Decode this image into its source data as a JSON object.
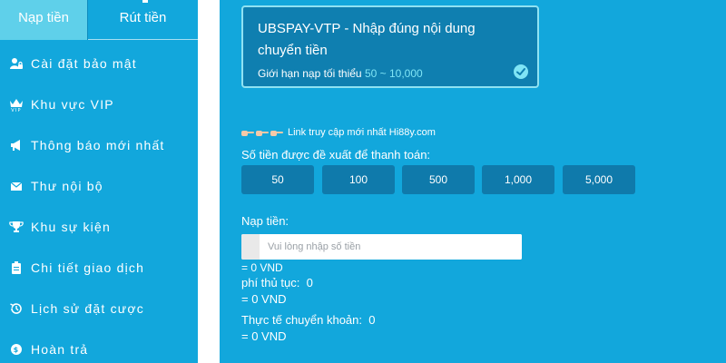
{
  "tabs": {
    "deposit": "Nạp tiền",
    "withdraw": "Rút tiền"
  },
  "sidebar": {
    "items": [
      {
        "label": "Cài đặt bảo mật",
        "icon": "user-lock-icon"
      },
      {
        "label": "Khu vực VIP",
        "icon": "vip-crown-icon"
      },
      {
        "label": "Thông báo mới nhất",
        "icon": "megaphone-icon"
      },
      {
        "label": "Thư nội bộ",
        "icon": "envelope-icon"
      },
      {
        "label": "Khu sự kiện",
        "icon": "trophy-icon"
      },
      {
        "label": "Chi tiết giao dịch",
        "icon": "clipboard-icon"
      },
      {
        "label": "Lịch sử đặt cược",
        "icon": "history-icon"
      },
      {
        "label": "Hoàn trả",
        "icon": "coin-icon"
      }
    ]
  },
  "payment_card": {
    "title": "UBSPAY-VTP - Nhập đúng nội dung chuyển tiền",
    "limit_prefix": "Giới hạn nạp tối thiểu",
    "limit_min": "50",
    "limit_sep": " ~ ",
    "limit_max": "10,000",
    "selected": true
  },
  "link_text": "Link truy cập mới nhất Hi88y.com",
  "suggest_label": "Số tiền được đề xuất để thanh toán:",
  "amounts": [
    "50",
    "100",
    "500",
    "1,000",
    "5,000"
  ],
  "deposit_label": "Nạp tiền:",
  "amount_input": {
    "placeholder": "Vui lòng nhập số tiền",
    "value": ""
  },
  "deposit_equiv": "= 0 VND",
  "fee_label": "phí thủ tục:",
  "fee_value": "0",
  "fee_equiv": "= 0 VND",
  "actual_label": "Thực tế chuyển khoản:",
  "actual_value": "0",
  "actual_equiv": "= 0 VND",
  "colors": {
    "sidebar_bg": "#12a7dc",
    "active_tab": "#5fd0ea",
    "card_bg": "#0f7fb0",
    "card_border": "#8fe2f2",
    "amount_button": "#0f7aab",
    "limit_highlight": "#7fe4f5"
  }
}
